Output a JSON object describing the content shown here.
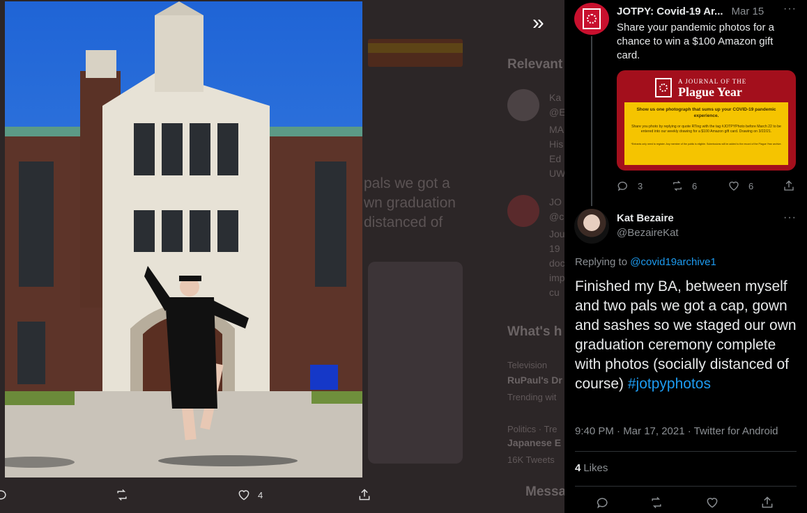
{
  "background": {
    "relevant_label": "Relevant",
    "whats_label": "What's h",
    "messages_label": "Messa",
    "overlay_text": "pals we got a\nwn graduation\ndistanced of",
    "col_lines_a": [
      "Ka",
      "@E",
      "MA",
      "His",
      "Ed",
      "UW"
    ],
    "col_lines_b": [
      "JO",
      "@c",
      "Jou",
      "19",
      "doc",
      "imp",
      "cu"
    ],
    "trend_1_cat": "Television",
    "trend_1_title": "RuPaul's Dr",
    "trend_1_sub": "Trending wit",
    "trend_2_cat": "Politics · Tre",
    "trend_2_title": "Japanese E",
    "trend_2_sub": "16K Tweets"
  },
  "photo_actions": {
    "like_count": "4"
  },
  "icons": {
    "expand": "double-chevron-right-icon",
    "reply": "speech-bubble-icon",
    "retweet": "retweet-icon",
    "like": "heart-icon",
    "share": "share-icon",
    "more": "more-dots-icon"
  },
  "colors": {
    "accent_blue": "#1d9bf0",
    "jotpy_red": "#c8102e",
    "promo_yellow": "#f5c400"
  },
  "quoted_tweet": {
    "name": "JOTPY: Covid-19 Ar...",
    "date": "Mar 15",
    "more": "···",
    "text": "Share your pandemic photos for a chance to win a $100 Amazon gift card.",
    "image": {
      "kicker": "A JOURNAL OF THE",
      "title": "Plague Year",
      "headline": "Show us one photograph that sums up your COVID-19 pandemic experience.",
      "body": "Share you photo by replying or quote RTing with the tag #JOTPYPhoto before March 22 to be entered into our weekly drawing for a $100 Amazon gift card. Drawing on 3/22/21.",
      "fine_print": "*Entrants only need to register. Any member of the public is eligible. Submissions will be added to the record of the Plague Year archive."
    },
    "replies": "3",
    "retweets": "6",
    "likes": "6"
  },
  "tweet": {
    "name": "Kat Bezaire",
    "handle": "@BezaireKat",
    "more": "···",
    "replying_label": "Replying to",
    "replying_to": "@covid19archive1",
    "text": "Finished my BA, between myself and two pals we got a cap, gown and sashes so we staged our own graduation ceremony complete with photos (socially distanced of course)",
    "hashtag": "#jotpyphotos",
    "meta": "9:40 PM · Mar 17, 2021 · Twitter for Android",
    "likes_count": "4",
    "likes_label": "Likes"
  }
}
